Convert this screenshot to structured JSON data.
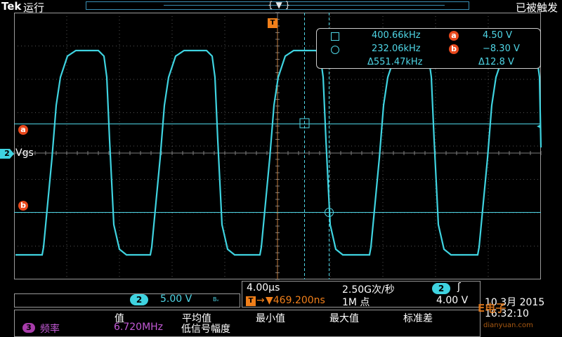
{
  "top": {
    "brand": "Tek",
    "run_state": "运行",
    "trigger_state": "已被触发"
  },
  "colors": {
    "trace": "#3fd3e0",
    "cursor": "#4fd6e6",
    "marker": "#e8481c",
    "trigger": "#f07f1a",
    "measure": "#c35ad6",
    "grid": "#8a8a8a"
  },
  "channel": {
    "tag": "2",
    "label": "Vgs",
    "scale": "5.00 V",
    "bw": "Bᵥ"
  },
  "markers": {
    "a": "a",
    "b": "b",
    "trigger": "T"
  },
  "cursors": {
    "row1": {
      "freq": "400.66kHz",
      "marker": "a",
      "value": "4.50 V"
    },
    "row2": {
      "freq": "232.06kHz",
      "marker": "b",
      "value": "−8.30 V"
    },
    "row3": {
      "freq": "Δ551.47kHz",
      "value": "Δ12.8 V"
    }
  },
  "timebase": {
    "scale": "4.00µs",
    "sample_rate": "2.50G次/秒",
    "trig_offset": "▼469.200ns",
    "record": "1M 点",
    "trig_channel": "2",
    "trig_level": "4.00 V",
    "trig_slope": "ʃ",
    "trig_arrow": "→"
  },
  "datetime": {
    "date": "10 3月  2015",
    "time": "16:32:10"
  },
  "measurements": {
    "headers": [
      "值",
      "平均值",
      "最小值",
      "最大值",
      "标准差"
    ],
    "row": {
      "index": "3",
      "name": "频率",
      "value": "6.720MHz",
      "note": "低信号幅度"
    }
  },
  "watermark": {
    "brand": "E电子",
    "url": "dianyuan.com"
  }
}
